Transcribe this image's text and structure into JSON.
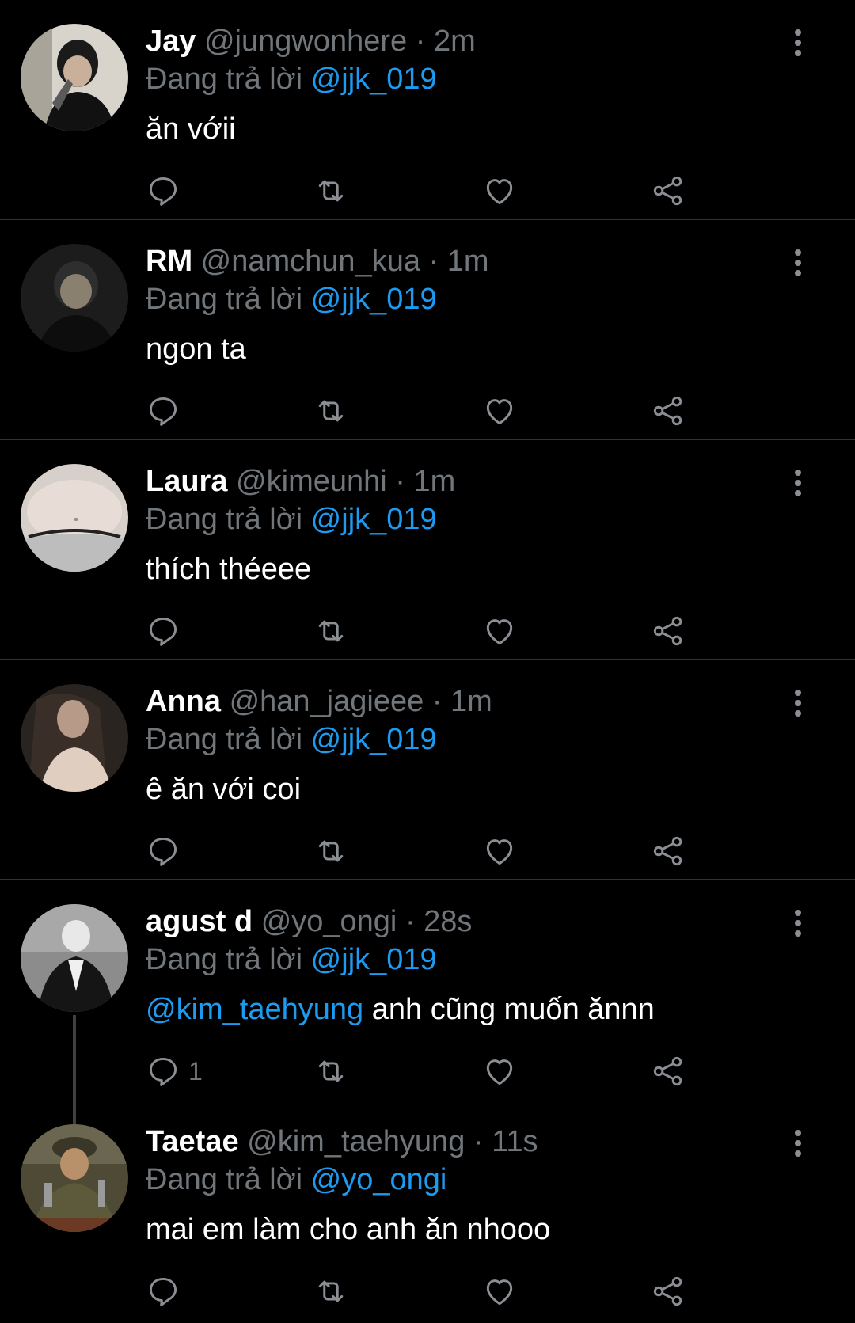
{
  "reply_prefix": "Đang trả lời",
  "separator": "·",
  "tweets": [
    {
      "name": "Jay",
      "handle": "@jungwonhere",
      "time": "2m",
      "replying_to": "@jjk_019",
      "mention": "",
      "text": "ăn vớii",
      "reply_count": ""
    },
    {
      "name": "RM",
      "handle": "@namchun_kua",
      "time": "1m",
      "replying_to": "@jjk_019",
      "mention": "",
      "text": "ngon ta",
      "reply_count": ""
    },
    {
      "name": "Laura",
      "handle": "@kimeunhi",
      "time": "1m",
      "replying_to": "@jjk_019",
      "mention": "",
      "text": "thích théeee",
      "reply_count": ""
    },
    {
      "name": "Anna",
      "handle": "@han_jagieee",
      "time": "1m",
      "replying_to": "@jjk_019",
      "mention": "",
      "text": "ê ăn với coi",
      "reply_count": ""
    },
    {
      "name": "agust d",
      "handle": "@yo_ongi",
      "time": "28s",
      "replying_to": "@jjk_019",
      "mention": "@kim_taehyung",
      "text": " anh cũng muốn ănnn",
      "reply_count": "1"
    },
    {
      "name": "Taetae",
      "handle": "@kim_taehyung",
      "time": "11s",
      "replying_to": "@yo_ongi",
      "mention": "",
      "text": "mai em làm cho anh ăn nhooo",
      "reply_count": ""
    }
  ],
  "icons": {
    "reply": "reply-icon",
    "retweet": "retweet-icon",
    "like": "heart-icon",
    "share": "share-icon",
    "more": "more-vertical-icon"
  },
  "colors": {
    "background": "#000000",
    "link": "#1d9bf0",
    "muted": "#71767b",
    "divider": "#2f3336"
  }
}
